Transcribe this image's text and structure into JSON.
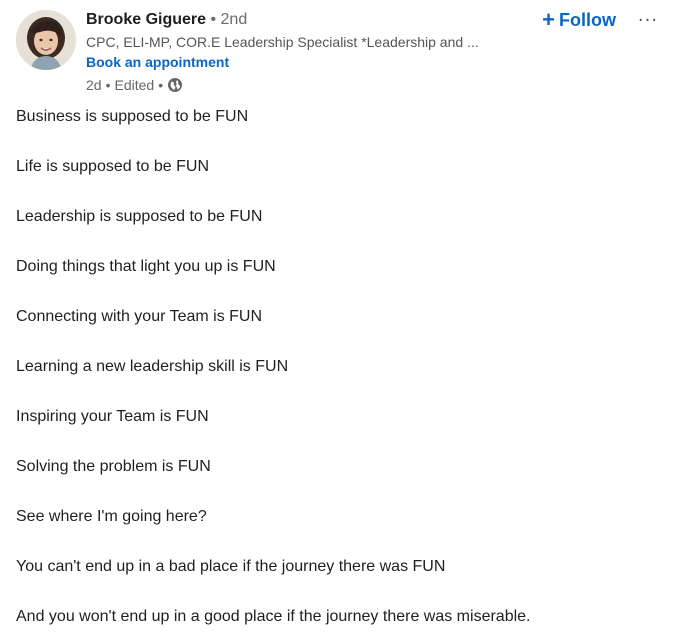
{
  "author": {
    "name": "Brooke Giguere",
    "separator": " • ",
    "degree": "2nd",
    "headline": "CPC, ELI-MP, COR.E Leadership Specialist *Leadership and ...",
    "link_label": "Book an appointment",
    "avatar_icon": "profile-photo"
  },
  "post_meta": {
    "time": "2d",
    "sep1": "•",
    "edited": "Edited",
    "sep2": "•",
    "visibility_icon": "globe-icon"
  },
  "actions": {
    "follow_icon": "+",
    "follow_label": "Follow",
    "more_label": "···"
  },
  "colors": {
    "link_blue": "#0a66c2",
    "text": "#1f1f1f",
    "secondary_text": "#666666"
  },
  "post": {
    "lines": [
      "Business is supposed to be FUN",
      "Life is supposed to be FUN",
      "Leadership is supposed to be FUN",
      "Doing things that light you up is FUN",
      "Connecting with your Team is FUN",
      "Learning a new leadership skill is FUN",
      "Inspiring your Team is FUN",
      "Solving the problem is FUN",
      "See where I'm going here?",
      "You can't end up in a bad place if the journey there was FUN",
      "And you won't end up in a good place if the journey there was miserable."
    ]
  }
}
